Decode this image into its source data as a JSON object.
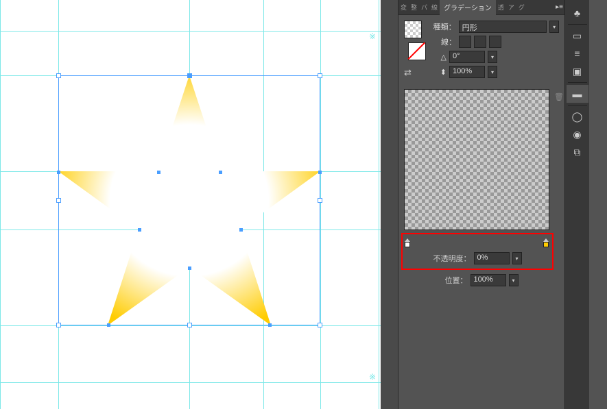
{
  "panel": {
    "tabs": [
      "変",
      "整",
      "パ",
      "線",
      "グラデーション",
      "透",
      "ア",
      "グ"
    ],
    "active_tab": "グラデーション",
    "type_label": "種類：",
    "type_value": "円形",
    "stroke_label": "線：",
    "angle_value": "0°",
    "ratio_value": "100%",
    "opacity_label": "不透明度：",
    "opacity_value": "0%",
    "position_label": "位置：",
    "position_value": "100%",
    "gradient_stops": [
      {
        "position": 0,
        "color": "#ffffff",
        "opacity": 0
      },
      {
        "position": 100,
        "color": "#ffcc00",
        "opacity": 100
      }
    ]
  },
  "dock_icons": [
    "club",
    "dashed-rect",
    "align",
    "layers",
    "gradient",
    "circle",
    "target",
    "overlap"
  ],
  "canvas": {
    "shape": "star",
    "fill_type": "radial_gradient",
    "center_color": "#ffffff",
    "edge_color": "#ffcc00"
  }
}
